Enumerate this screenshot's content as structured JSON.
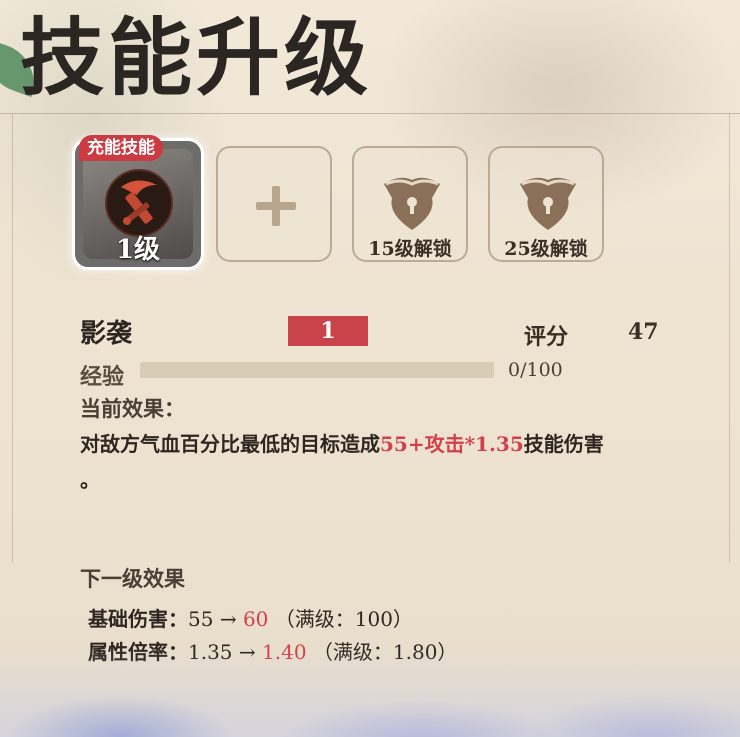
{
  "header": {
    "title": "技能升级"
  },
  "slots": {
    "active": {
      "badge": "充能技能",
      "level": "1级",
      "icon": "sword-emblem-icon"
    },
    "add": {
      "icon": "plus-icon"
    },
    "locked": [
      {
        "label": "15级解锁",
        "icon": "lock-icon"
      },
      {
        "label": "25级解锁",
        "icon": "lock-icon"
      }
    ]
  },
  "skill": {
    "name": "影袭",
    "level_tag": "1",
    "score_label": "评分",
    "score_value": "47"
  },
  "exp": {
    "label": "经验",
    "value": "0/100",
    "progress": 0
  },
  "current_effect": {
    "heading": "当前效果：",
    "prefix": "对敌方气血百分比最低的目标造成",
    "highlight": "55+攻击*1.35",
    "suffix": "技能伤害",
    "tail": "。"
  },
  "next_effect": {
    "heading": "下一级效果",
    "lines": [
      {
        "label": "基础伤害：",
        "from": "55",
        "arrow": "→",
        "to": "60",
        "max": "（满级：100）"
      },
      {
        "label": "属性倍率：",
        "from": "1.35",
        "arrow": "→",
        "to": "1.40",
        "max": "（满级：1.80）"
      }
    ]
  },
  "colors": {
    "accent_red": "#d1404b",
    "badge_red": "#cc3a42",
    "level_tag": "#c9434a"
  }
}
